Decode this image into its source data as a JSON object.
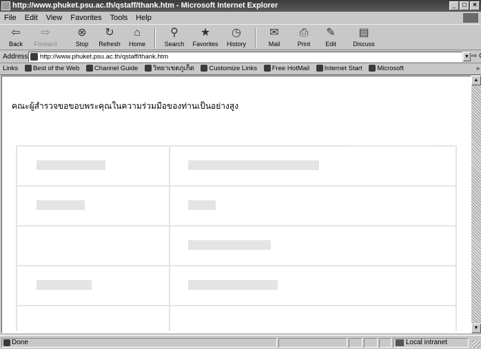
{
  "window": {
    "title": "http://www.phuket.psu.ac.th/qstaff/thank.htm - Microsoft Internet Explorer",
    "controls": [
      "_",
      "□",
      "×"
    ]
  },
  "menubar": {
    "items": [
      "File",
      "Edit",
      "View",
      "Favorites",
      "Tools",
      "Help"
    ]
  },
  "toolbar": {
    "back": "Back",
    "forward": "Forward",
    "stop": "Stop",
    "refresh": "Refresh",
    "home": "Home",
    "search": "Search",
    "favorites": "Favorites",
    "history": "History",
    "mail": "Mail",
    "print": "Print",
    "edit": "Edit",
    "discuss": "Discuss"
  },
  "address": {
    "label": "Address",
    "value": "http://www.phuket.psu.ac.th/qstaff/thank.htm",
    "go": "Go"
  },
  "links": {
    "label": "Links",
    "items": [
      "Best of the Web",
      "Channel Guide",
      "วิทยาเขตภูเก็ต",
      "Customize Links",
      "Free HotMail",
      "Internet Start",
      "Microsoft"
    ],
    "more": "»"
  },
  "page": {
    "message": "คณะผู้สำรวจขอขอบพระคุณในความร่วมมือของท่านเป็นอย่างสูง"
  },
  "status": {
    "text": "Done",
    "zone": "Local intranet"
  }
}
